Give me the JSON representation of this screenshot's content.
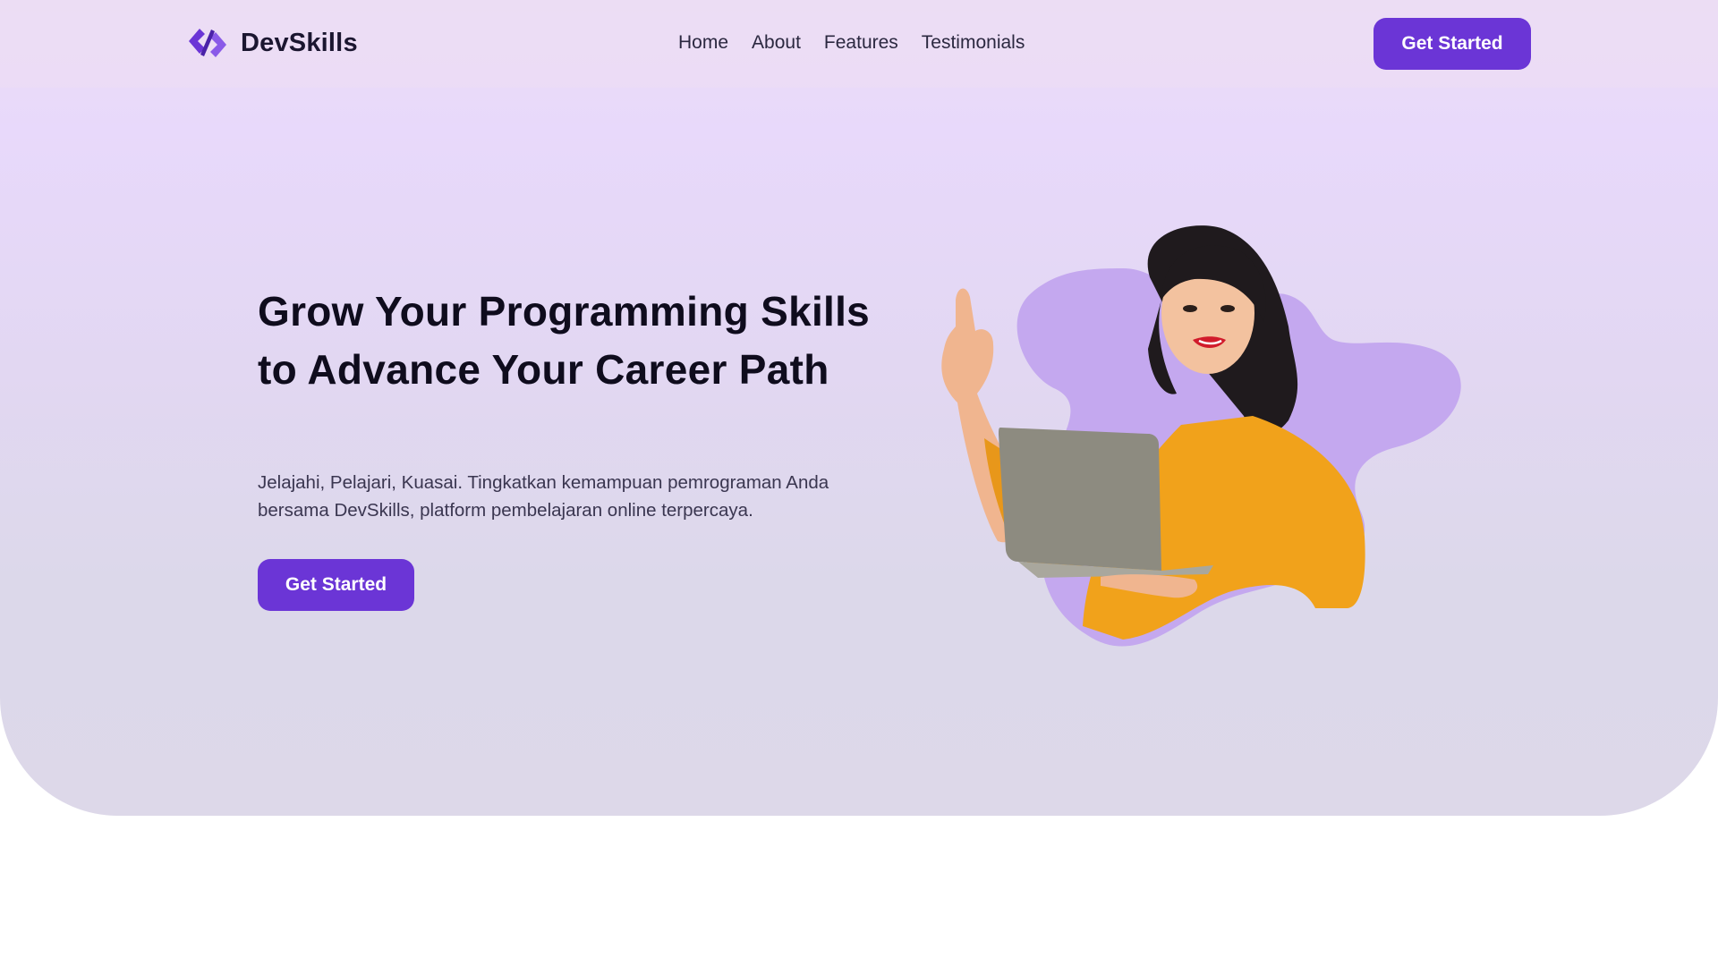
{
  "brand": {
    "name": "DevSkills",
    "accent": "#6b35d6"
  },
  "nav": {
    "links": [
      "Home",
      "About",
      "Features",
      "Testimonials"
    ],
    "cta_label": "Get Started"
  },
  "hero": {
    "title": "Grow Your Programming Skills to Advance Your Career Path",
    "description": "Jelajahi, Pelajari, Kuasai. Tingkatkan kemampuan pemrograman Anda bersama DevSkills, platform pembelajaran online terpercaya.",
    "cta_label": "Get Started"
  },
  "icons": {
    "logo": "code-diamond-logo-icon"
  }
}
